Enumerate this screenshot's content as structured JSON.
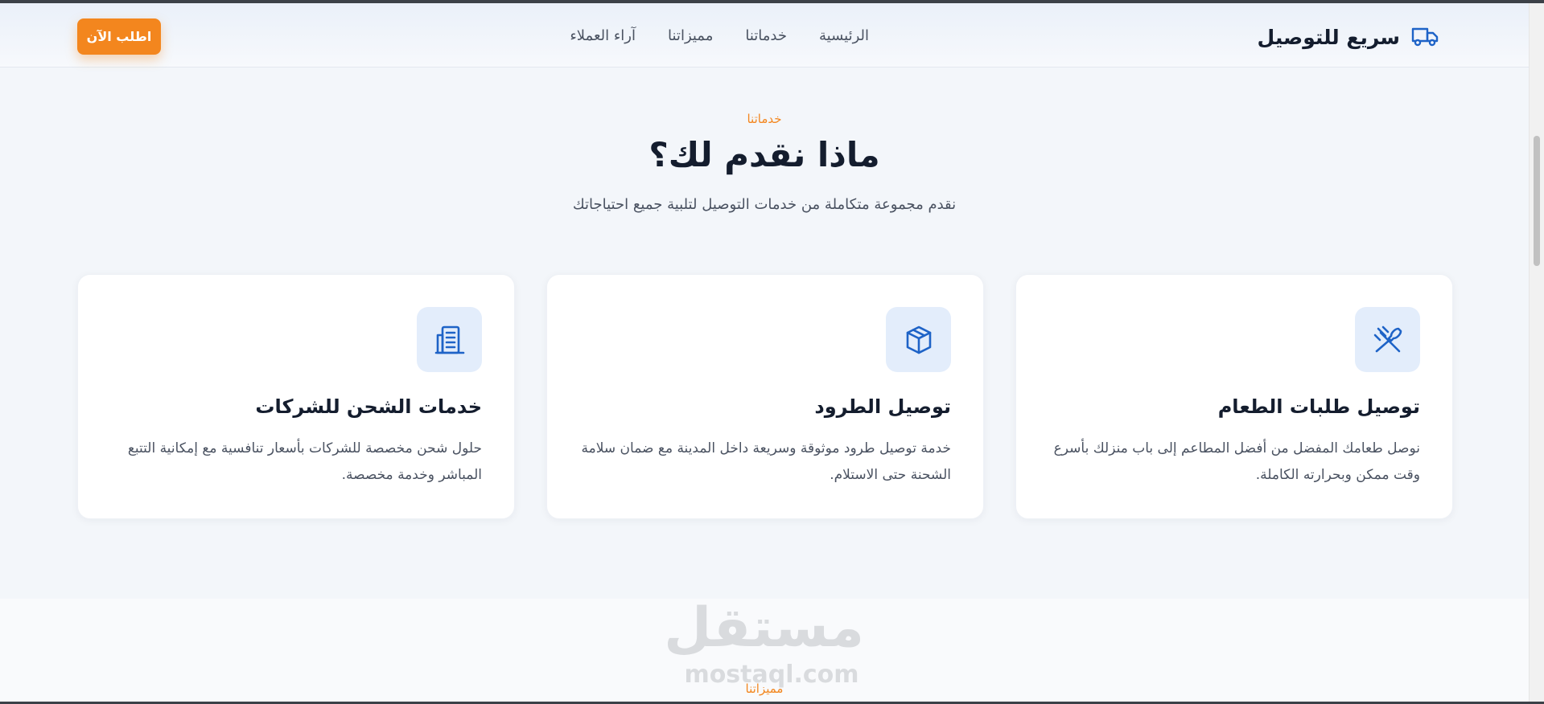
{
  "header": {
    "brand_name": "سريع للتوصيل",
    "brand_icon": "truck-icon",
    "nav": [
      "الرئيسية",
      "خدماتنا",
      "مميزاتنا",
      "آراء العملاء"
    ],
    "cta_label": "اطلب الآن"
  },
  "section": {
    "eyebrow": "خدماتنا",
    "title": "ماذا نقدم لك؟",
    "subtitle": "نقدم مجموعة متكاملة من خدمات التوصيل لتلبية جميع احتياجاتك"
  },
  "cards": [
    {
      "icon": "utensils-icon",
      "title": "توصيل طلبات الطعام",
      "desc": "نوصل طعامك المفضل من أفضل المطاعم إلى باب منزلك بأسرع وقت ممكن وبحرارته الكاملة."
    },
    {
      "icon": "box-icon",
      "title": "توصيل الطرود",
      "desc": "خدمة توصيل طرود موثوقة وسريعة داخل المدينة مع ضمان سلامة الشحنة حتى الاستلام."
    },
    {
      "icon": "building-icon",
      "title": "خدمات الشحن للشركات",
      "desc": "حلول شحن مخصصة للشركات بأسعار تنافسية مع إمكانية التتبع المباشر وخدمة مخصصة."
    }
  ],
  "next_section": {
    "eyebrow": "مميزاتنا"
  },
  "watermark": {
    "arabic": "مستقل",
    "latin": "mostaql.com"
  },
  "colors": {
    "accent": "#f3861e",
    "primary_icon": "#1e63c7",
    "heading": "#141d2e",
    "body_text": "#4a5261"
  }
}
